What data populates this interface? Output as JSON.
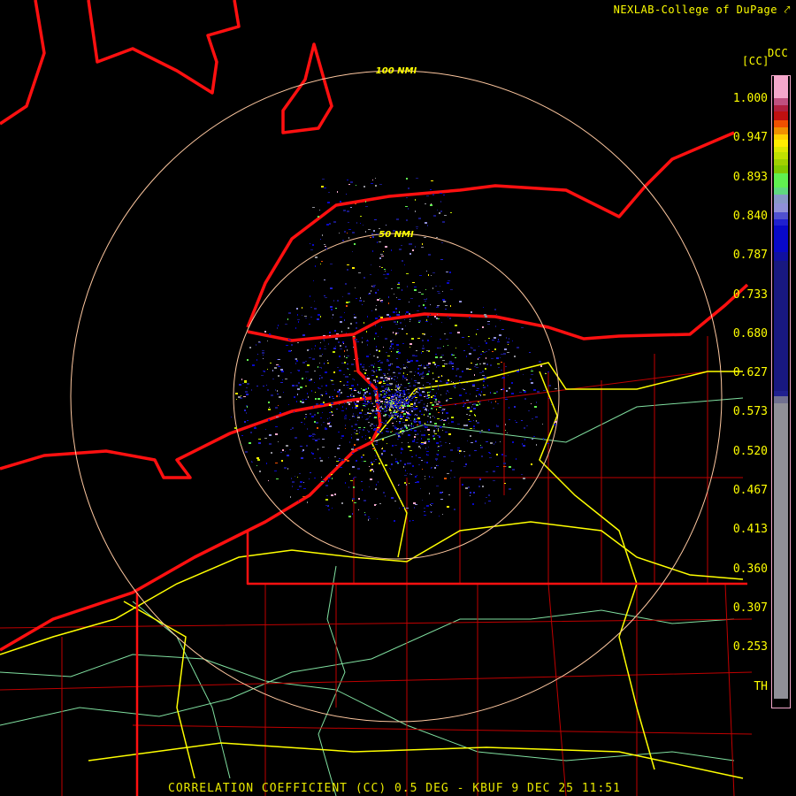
{
  "header": {
    "credit": "NEXLAB-College of DuPage",
    "credit_icon": "external-link-icon"
  },
  "footer": {
    "caption": "CORRELATION COEFFICIENT (CC) 0.5 DEG - KBUF 9 DEC 25 11:51"
  },
  "map": {
    "radar_site": "KBUF",
    "range_rings": [
      {
        "label": "100 NMI"
      },
      {
        "label": "50 NMI"
      }
    ],
    "colors": {
      "state_borders": "#ff0000",
      "county_lines": "#c00000",
      "highways": "#ffff00",
      "roads": "#80e0a0",
      "range_rings": "#ffc8a0"
    }
  },
  "legend": {
    "product": "DCC",
    "unit": "[CC]",
    "ticks": [
      "1.000",
      "0.947",
      "0.893",
      "0.840",
      "0.787",
      "0.733",
      "0.680",
      "0.627",
      "0.573",
      "0.520",
      "0.467",
      "0.413",
      "0.360",
      "0.307",
      "0.253",
      "TH"
    ],
    "colors": [
      "#f5a8cc",
      "#c05080",
      "#b02040",
      "#c01010",
      "#f05000",
      "#f09000",
      "#ffd000",
      "#ffee00",
      "#dde800",
      "#c0e000",
      "#a0d000",
      "#80c800",
      "#60f050",
      "#60d880",
      "#8898c8",
      "#9090d8",
      "#5050d0",
      "#2020d0",
      "#0808c8",
      "#1010a0",
      "#181880",
      "#202090",
      "#707090",
      "#909098",
      "#000000"
    ]
  }
}
